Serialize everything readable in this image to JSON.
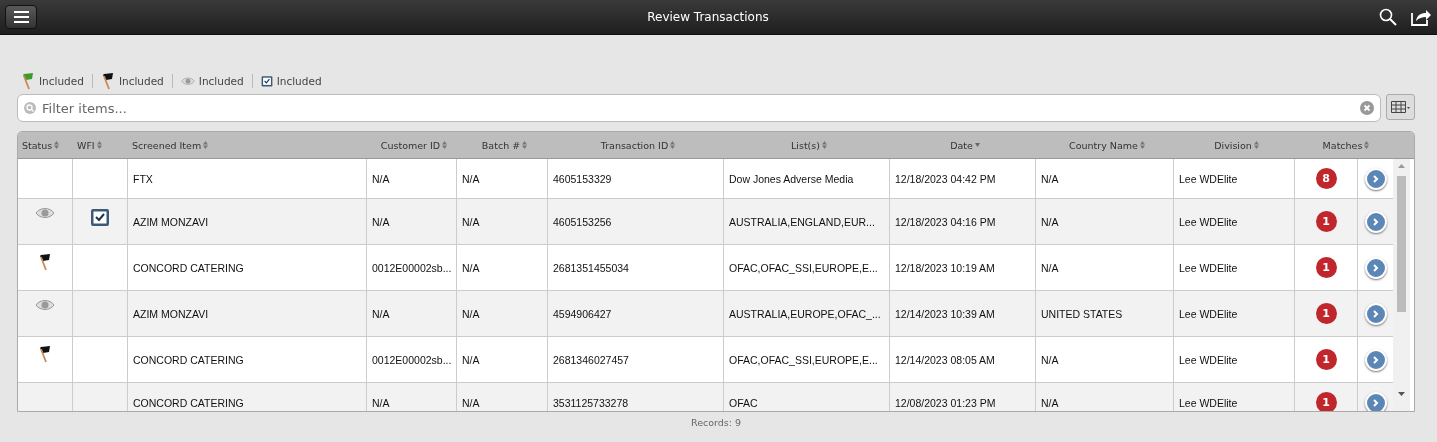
{
  "title": "Review Transactions",
  "legend": [
    {
      "kind": "green-flag",
      "label": "Included"
    },
    {
      "kind": "black-flag",
      "label": "Included"
    },
    {
      "kind": "eye",
      "label": "Included"
    },
    {
      "kind": "checkbox",
      "label": "Included"
    }
  ],
  "filter": {
    "placeholder": "Filter items..."
  },
  "columns": [
    {
      "label": "Status",
      "sorted": false
    },
    {
      "label": "WFI",
      "sorted": false
    },
    {
      "label": "Screened Item",
      "sorted": false
    },
    {
      "label": "Customer ID",
      "sorted": false
    },
    {
      "label": "Batch #",
      "sorted": false
    },
    {
      "label": "Transaction ID",
      "sorted": false
    },
    {
      "label": "List(s)",
      "sorted": false
    },
    {
      "label": "Date",
      "sorted": true
    },
    {
      "label": "Country Name",
      "sorted": false
    },
    {
      "label": "Division",
      "sorted": false
    },
    {
      "label": "Matches",
      "sorted": false
    }
  ],
  "rows": [
    {
      "kind": "plain",
      "wfi": false,
      "item": "FTX",
      "customer_id": "N/A",
      "batch": "N/A",
      "transaction_id": "4605153329",
      "lists": "Dow Jones Adverse Media",
      "date": "12/18/2023 04:42 PM",
      "country": "N/A",
      "division": "Lee WDElite",
      "matches": "8"
    },
    {
      "kind": "eye",
      "wfi": true,
      "item": "AZIM MONZAVI",
      "customer_id": "N/A",
      "batch": "N/A",
      "transaction_id": "4605153256",
      "lists": "AUSTRALIA,ENGLAND,EUR...",
      "date": "12/18/2023 04:16 PM",
      "country": "N/A",
      "division": "Lee WDElite",
      "matches": "1"
    },
    {
      "kind": "flag",
      "wfi": false,
      "item": "CONCORD CATERING",
      "customer_id": "0012E00002sb...",
      "batch": "N/A",
      "transaction_id": "2681351455034",
      "lists": "OFAC,OFAC_SSI,EUROPE,E...",
      "date": "12/18/2023 10:19 AM",
      "country": "N/A",
      "division": "Lee WDElite",
      "matches": "1"
    },
    {
      "kind": "eye",
      "wfi": false,
      "item": "AZIM MONZAVI",
      "customer_id": "N/A",
      "batch": "N/A",
      "transaction_id": "4594906427",
      "lists": "AUSTRALIA,EUROPE,OFAC_...",
      "date": "12/14/2023 10:39 AM",
      "country": "UNITED STATES",
      "division": "Lee WDElite",
      "matches": "1"
    },
    {
      "kind": "flag",
      "wfi": false,
      "item": "CONCORD CATERING",
      "customer_id": "0012E00002sb...",
      "batch": "N/A",
      "transaction_id": "2681346027457",
      "lists": "OFAC,OFAC_SSI,EUROPE,E...",
      "date": "12/14/2023 08:05 AM",
      "country": "N/A",
      "division": "Lee WDElite",
      "matches": "1"
    },
    {
      "kind": "plain",
      "wfi": false,
      "item": "CONCORD CATERING",
      "customer_id": "N/A",
      "batch": "N/A",
      "transaction_id": "3531125733278",
      "lists": "OFAC",
      "date": "12/08/2023 01:23 PM",
      "country": "N/A",
      "division": "Lee WDElite",
      "matches": "1"
    }
  ],
  "records": "Records: 9"
}
